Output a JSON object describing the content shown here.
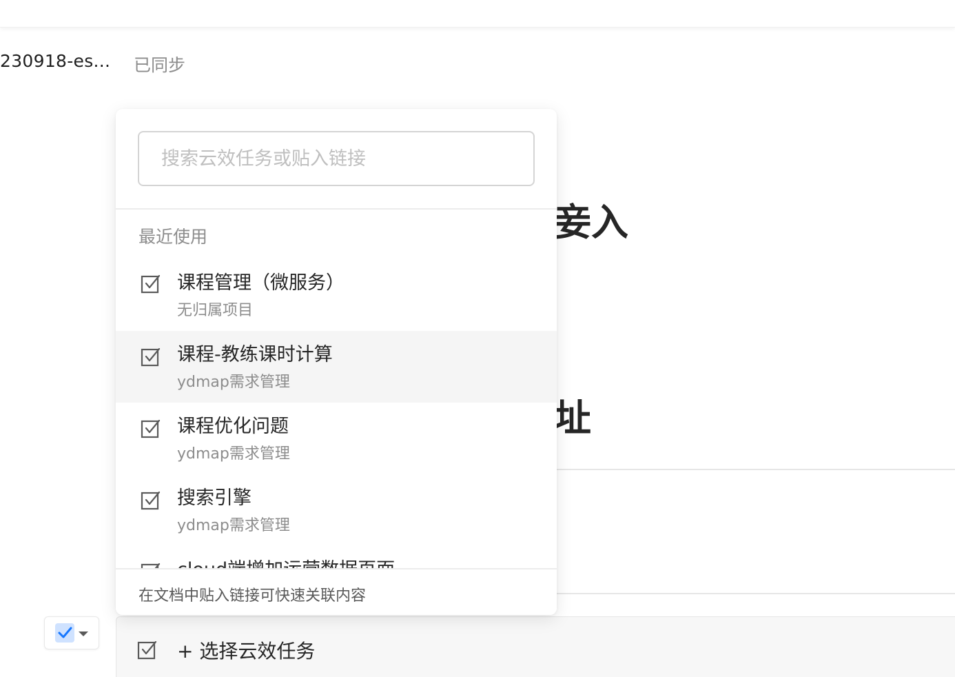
{
  "header": {
    "doc_name": "230918-es...",
    "sync_status": "已同步"
  },
  "document": {
    "heading_fragment_1": "妾入",
    "heading_fragment_2": "址"
  },
  "task_picker": {
    "search_placeholder": "搜索云效任务或贴入链接",
    "section_title": "最近使用",
    "items": [
      {
        "title": "课程管理（微服务）",
        "project": "无归属项目"
      },
      {
        "title": "课程-教练课时计算",
        "project": "ydmap需求管理"
      },
      {
        "title": "课程优化问题",
        "project": "ydmap需求管理"
      },
      {
        "title": "搜索引擎",
        "project": "ydmap需求管理"
      },
      {
        "title": "cloud端增加运营数据页面",
        "project": ""
      }
    ],
    "hovered_index": 1,
    "footer_hint": "在文档中贴入链接可快速关联内容"
  },
  "task_block": {
    "select_label": "+ 选择云效任务"
  },
  "colors": {
    "accent_blue": "#1677ff",
    "hover_bg": "#f5f5f5",
    "muted_text": "#8c8c8c"
  }
}
